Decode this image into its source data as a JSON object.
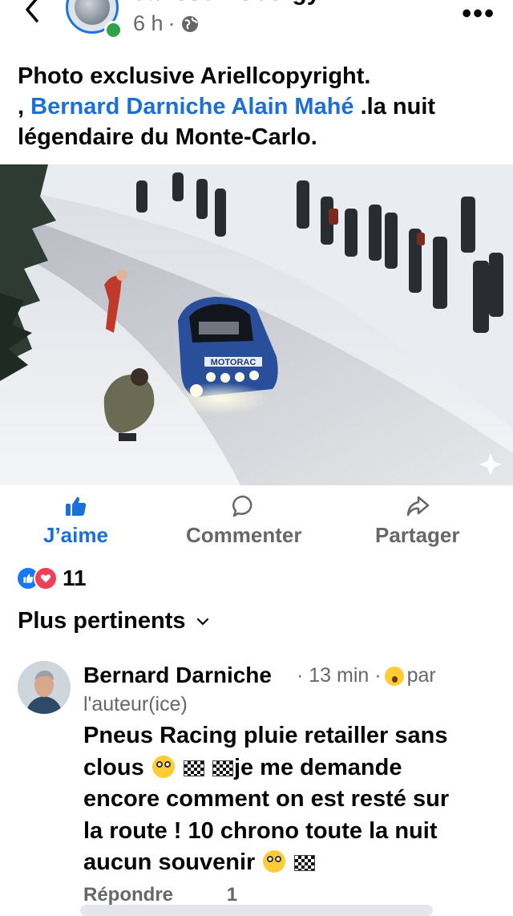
{
  "header": {
    "author": "Janssen Georgy",
    "time": "6 h",
    "separator": "·",
    "privacy_icon": "globe-icon",
    "more_label": "•••"
  },
  "post": {
    "line1": "Photo exclusive Ariellcopyright.",
    "line2_prefix": ", ",
    "mention1": "Bernard Darniche",
    "mention2": "Alain Mahé",
    "line2_suffix": " .la nuit",
    "line3": "légendaire du Monte-Carlo."
  },
  "photo": {
    "car_text": "MOTORAC"
  },
  "actions": {
    "like": "J’aime",
    "comment": "Commenter",
    "share": "Partager"
  },
  "reactions": {
    "count": "11"
  },
  "sort": {
    "label": "Plus pertinents"
  },
  "comment": {
    "author": "Bernard Darniche",
    "time": "· 13 min ·",
    "by": "par",
    "by2": "l'auteur(ice)",
    "line1": "Pneus Racing pluie retailler sans",
    "line2_a": "clous ",
    "line2_b": "je me demande",
    "line3": "encore comment on est resté sur",
    "line4": "la route ! 10 chrono toute la nuit",
    "line5": "aucun souvenir ",
    "reply": "Répondre",
    "reaction_count": "1"
  },
  "colors": {
    "accent": "#1b6fd6",
    "secondary_text": "#65676b",
    "like_blue": "#1877f2",
    "love_red": "#f33e58",
    "online_green": "#31a24c"
  }
}
